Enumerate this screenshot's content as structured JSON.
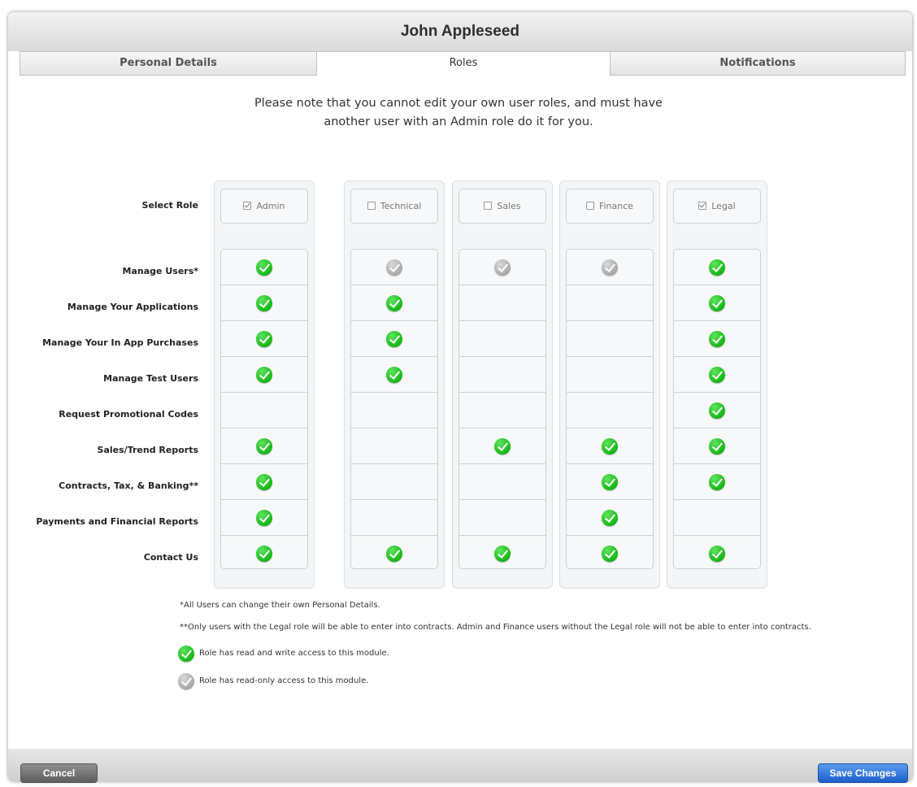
{
  "window": {
    "title": "John Appleseed"
  },
  "tabs": [
    {
      "label": "Personal Details",
      "active": false
    },
    {
      "label": "Roles",
      "active": true
    },
    {
      "label": "Notifications",
      "active": false
    }
  ],
  "note": {
    "line1": "Please note that you cannot edit your own user roles, and must have",
    "line2": "another user with an Admin role do it for you."
  },
  "select_role_label": "Select Role",
  "modules": [
    "Manage Users*",
    "Manage Your Applications",
    "Manage Your In App Purchases",
    "Manage Test Users",
    "Request Promotional Codes",
    "Sales/Trend Reports",
    "Contracts, Tax, & Banking**",
    "Payments and Financial Reports",
    "Contact Us"
  ],
  "roles": [
    {
      "name": "Admin",
      "checked": true,
      "access": [
        "rw",
        "rw",
        "rw",
        "rw",
        "",
        "rw",
        "rw",
        "rw",
        "rw"
      ]
    },
    {
      "name": "Technical",
      "checked": false,
      "access": [
        "ro",
        "rw",
        "rw",
        "rw",
        "",
        "",
        "",
        "",
        "rw"
      ]
    },
    {
      "name": "Sales",
      "checked": false,
      "access": [
        "ro",
        "",
        "",
        "",
        "",
        "rw",
        "",
        "",
        "rw"
      ]
    },
    {
      "name": "Finance",
      "checked": false,
      "access": [
        "ro",
        "",
        "",
        "",
        "",
        "rw",
        "rw",
        "rw",
        "rw"
      ]
    },
    {
      "name": "Legal",
      "checked": true,
      "access": [
        "rw",
        "rw",
        "rw",
        "rw",
        "rw",
        "rw",
        "rw",
        "",
        "rw"
      ]
    }
  ],
  "footnotes": [
    "*All Users can change their own Personal Details.",
    "**Only users with the Legal role will be able to enter into contracts. Admin and Finance users without the Legal role will not be able to enter into contracts."
  ],
  "legend": {
    "rw": "Role has read and write access to this module.",
    "ro": "Role has read-only access to this module."
  },
  "buttons": {
    "cancel": "Cancel",
    "save": "Save Changes"
  },
  "colors": {
    "accent_blue": "#1c5fcb",
    "check_green": "#14b814",
    "check_gray": "#a8a8a8"
  }
}
